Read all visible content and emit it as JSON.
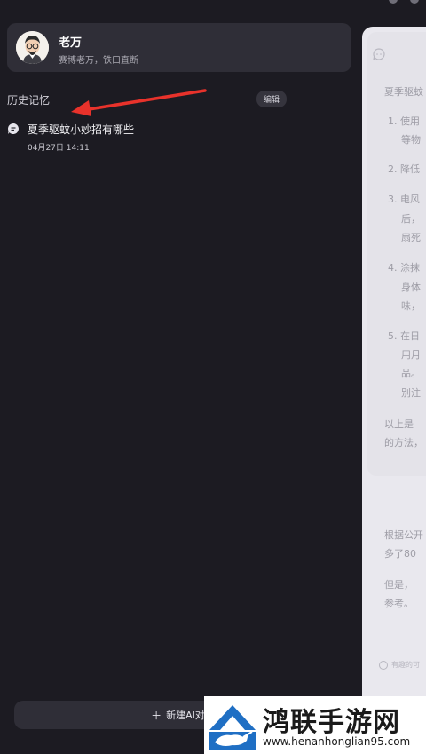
{
  "profile": {
    "name": "老万",
    "subtitle": "赛博老万，铁口直断"
  },
  "history": {
    "section_title": "历史记忆",
    "edit_label": "编辑",
    "items": [
      {
        "title": "夏季驱蚊小妙招有哪些",
        "time": "04月27日 14:11"
      }
    ]
  },
  "new_chat": {
    "label": "新建AI对话"
  },
  "chat_panel": {
    "lines": [
      "夏季驱蚊",
      "1. 使用",
      "等物",
      "2. 降低",
      "3. 电风",
      "后，",
      "扇死",
      "4. 涂抹",
      "身体",
      "味，",
      "5. 在日",
      "用月",
      "品。",
      "别注",
      "以上是",
      "的方法，",
      "根据公开",
      "多了80",
      "但是，",
      "参考。",
      "有趣的可"
    ]
  },
  "watermark": {
    "title": "鸿联手游网",
    "url": "www.henanhonglian95.com"
  },
  "colors": {
    "background": "#1c1b22",
    "card": "#2f2e37",
    "arrow": "#e8322b"
  }
}
